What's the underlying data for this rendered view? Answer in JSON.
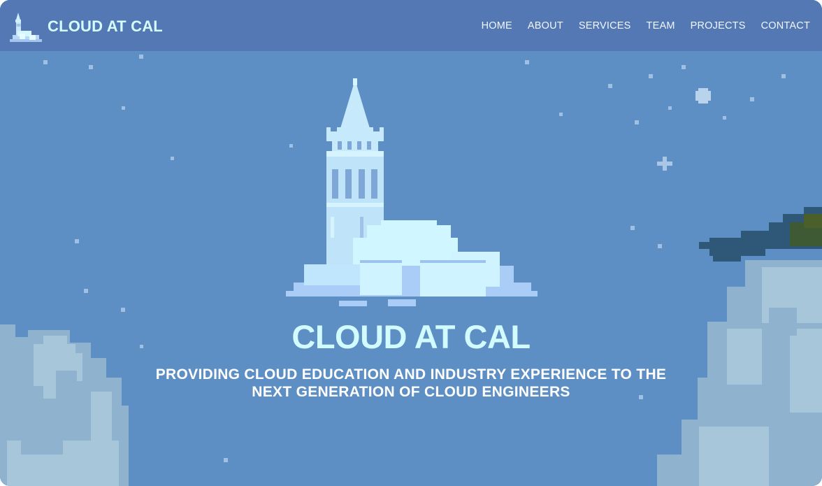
{
  "navbar": {
    "brand_name": "CLOUD AT CAL",
    "links": [
      {
        "label": "HOME"
      },
      {
        "label": "ABOUT"
      },
      {
        "label": "SERVICES"
      },
      {
        "label": "TEAM"
      },
      {
        "label": "PROJECTS"
      },
      {
        "label": "CONTACT"
      }
    ]
  },
  "hero": {
    "title": "CLOUD AT CAL",
    "tagline_line1": "PROVIDING CLOUD EDUCATION AND INDUSTRY EXPERIENCE TO THE",
    "tagline_line2": "NEXT GENERATION OF CLOUD ENGINEERS"
  },
  "icons": {
    "brand_logo": "campanile-cloud-icon",
    "hero_logo": "campanile-cloud-icon",
    "decor": [
      "star-icon",
      "pixel-cloud-icon",
      "pixel-tree-icon"
    ]
  },
  "colors": {
    "sky": "#5d8fc4",
    "navbar": "#5478b3",
    "title": "#d2fbff",
    "tagline": "#ffffff",
    "nav_text": "#f2f7ff",
    "cloud_light": "#cff4ff",
    "cloud_mid": "#a8cdf4",
    "side_cloud": "#8fb3cf"
  }
}
